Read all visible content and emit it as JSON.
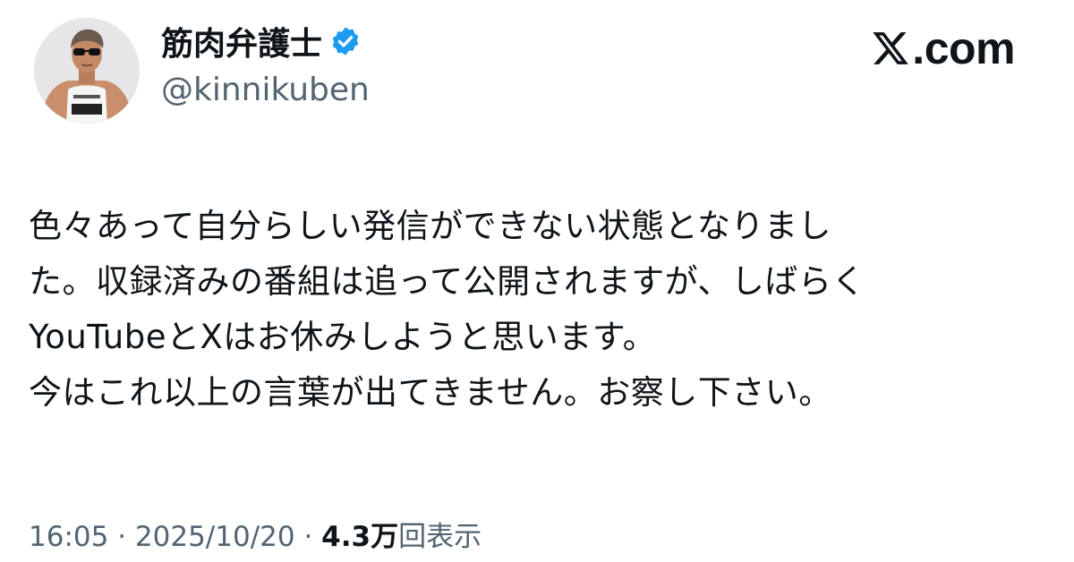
{
  "author": {
    "display_name": "筋肉弁護士",
    "handle": "@kinnikuben",
    "verified_badge_color": "#1d9bf0",
    "avatar_icon": "profile-photo"
  },
  "brand": {
    "suffix": ".com",
    "icon": "x-logo-icon"
  },
  "tweet": {
    "lines": [
      "色々あって自分らしい発信ができない状態となりまし",
      "た。収録済みの番組は追って公開されますが、しばらく",
      "YouTubeとXはお休みしようと思います。",
      "今はこれ以上の言葉が出てきません。お察し下さい。"
    ]
  },
  "meta": {
    "time": "16:05",
    "separator": " · ",
    "date": "2025/10/20",
    "views_count": "4.3万",
    "views_label": "回表示"
  }
}
